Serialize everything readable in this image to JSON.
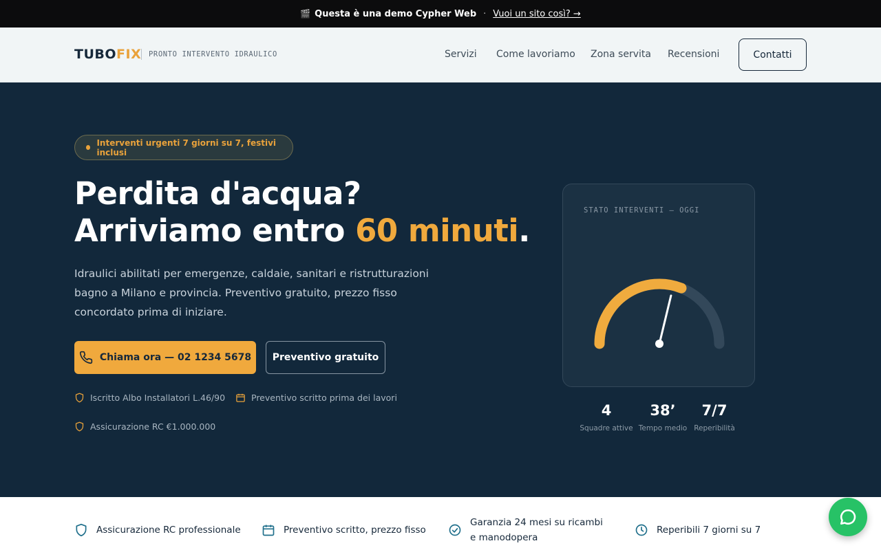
{
  "demo_bar": {
    "icon": "clapperboard-icon",
    "text": "Questa è una demo Cypher Web",
    "separator": "·",
    "link": "Vuoi un sito così? →"
  },
  "header": {
    "logo_part1": "TUBO",
    "logo_part2": "FIX",
    "tagline": "PRONTO INTERVENTO IDRAULICO",
    "nav": [
      "Servizi",
      "Come lavoriamo",
      "Zona servita",
      "Recensioni"
    ],
    "contact_label": "Contatti"
  },
  "hero": {
    "badge": "Interventi urgenti 7 giorni su 7, festivi inclusi",
    "title_line1": "Perdita d'acqua?",
    "title_line2_pre": "Arriviamo entro ",
    "title_line2_accent": "60 minuti",
    "title_line2_post": ".",
    "lead": "Idraulici abilitati per emergenze, caldaie, sanitari e ristrutturazioni bagno a Milano e provincia. Preventivo gratuito, prezzo fisso concordato prima di iniziare.",
    "cta_call": "Chiama ora — 02 1234 5678",
    "cta_quote": "Preventivo gratuito",
    "trust": [
      "Iscritto Albo Installatori L.46/90",
      "Preventivo scritto prima dei lavori",
      "Assicurazione RC €1.000.000"
    ]
  },
  "status_card": {
    "title": "STATO INTERVENTI — OGGI",
    "gauge_fraction": 0.62,
    "stats": [
      {
        "value": "4",
        "label": "Squadre attive"
      },
      {
        "value": "38’",
        "label": "Tempo medio"
      },
      {
        "value": "7/7",
        "label": "Reperibilità"
      }
    ]
  },
  "features": [
    "Assicurazione RC professionale",
    "Preventivo scritto, prezzo fisso",
    "Garanzia 24 mesi su ricambi e manodopera",
    "Reperibili 7 giorni su 7"
  ],
  "colors": {
    "navy": "#12283b",
    "accent": "#f0a93d",
    "chat_green": "#27c266"
  }
}
